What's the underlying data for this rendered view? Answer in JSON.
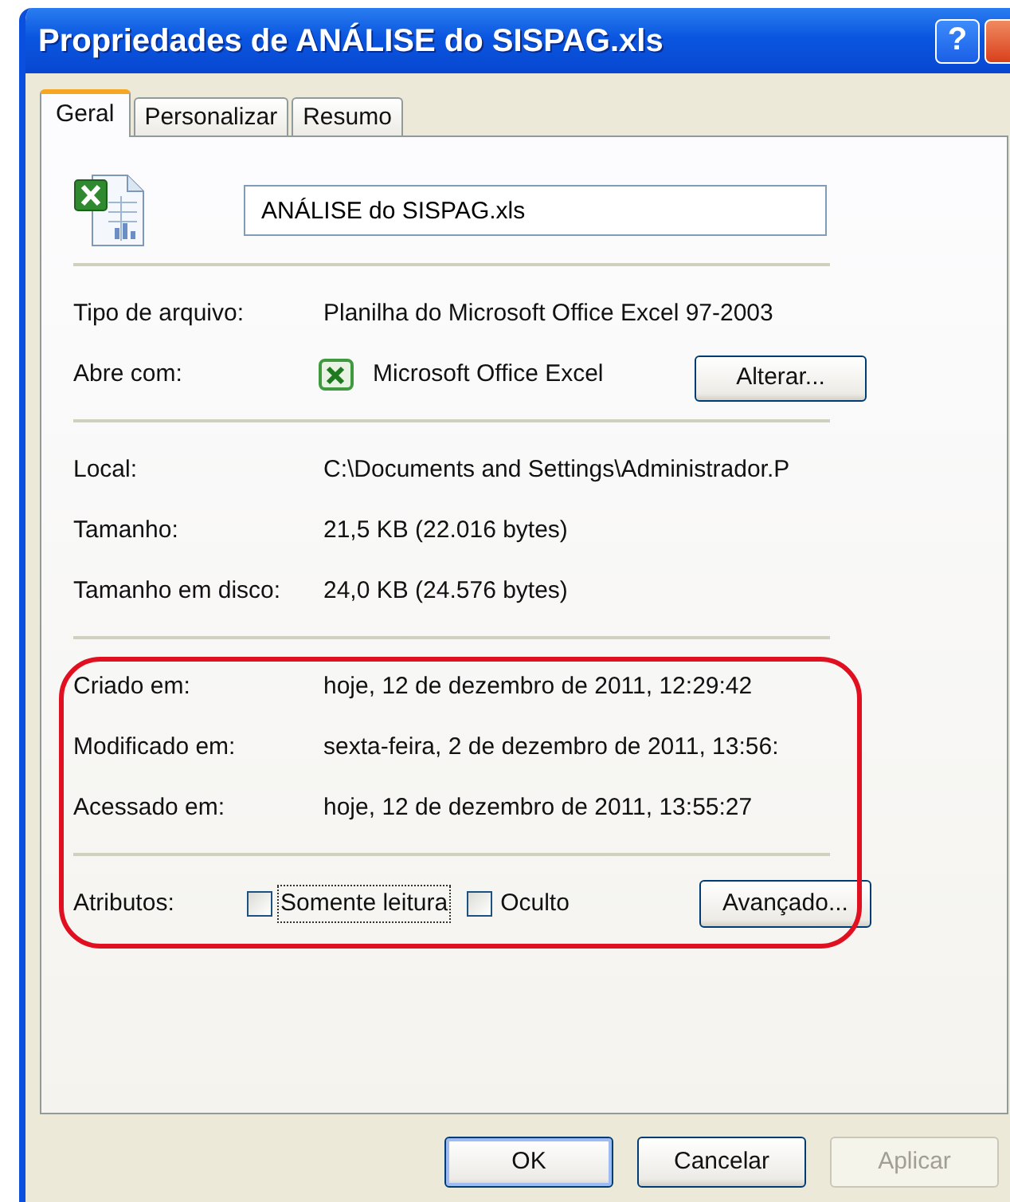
{
  "window": {
    "title": "Propriedades de ANÁLISE do SISPAG.xls",
    "help_button": "?"
  },
  "tabs": [
    {
      "label": "Geral",
      "selected": true
    },
    {
      "label": "Personalizar",
      "selected": false
    },
    {
      "label": "Resumo",
      "selected": false
    }
  ],
  "file_name": {
    "value": "ANÁLISE do SISPAG.xls"
  },
  "sections": [
    {
      "rows": [
        {
          "kind": "text",
          "label": "Tipo de arquivo:",
          "value": "Planilha do Microsoft Office Excel 97-2003"
        },
        {
          "kind": "app",
          "label": "Abre com:",
          "value": "Microsoft Office Excel",
          "button": "Alterar..."
        }
      ]
    },
    {
      "rows": [
        {
          "kind": "text",
          "label": "Local:",
          "value": "C:\\Documents and Settings\\Administrador.P"
        },
        {
          "kind": "text",
          "label": "Tamanho:",
          "value": "21,5 KB (22.016 bytes)"
        },
        {
          "kind": "text",
          "label": "Tamanho em disco:",
          "value": "24,0 KB (24.576 bytes)"
        }
      ]
    },
    {
      "highlighted": true,
      "rows": [
        {
          "kind": "text",
          "label": "Criado em:",
          "value": "hoje, 12 de dezembro de 2011, 12:29:42"
        },
        {
          "kind": "text",
          "label": "Modificado em:",
          "value": "sexta-feira, 2 de dezembro de 2011, 13:56:"
        },
        {
          "kind": "text",
          "label": "Acessado em:",
          "value": "hoje, 12 de dezembro de 2011, 13:55:27"
        }
      ]
    },
    {
      "highlighted": true,
      "rows": [
        {
          "kind": "attributes",
          "label": "Atributos:",
          "checkboxes": [
            {
              "label": "Somente leitura",
              "checked": false,
              "focused": true
            },
            {
              "label": "Oculto",
              "checked": false,
              "focused": false
            }
          ],
          "button": "Avançado..."
        }
      ]
    }
  ],
  "buttons": [
    {
      "label": "OK",
      "default": true,
      "disabled": false
    },
    {
      "label": "Cancelar",
      "default": false,
      "disabled": false
    },
    {
      "label": "Aplicar",
      "default": false,
      "disabled": true
    }
  ]
}
